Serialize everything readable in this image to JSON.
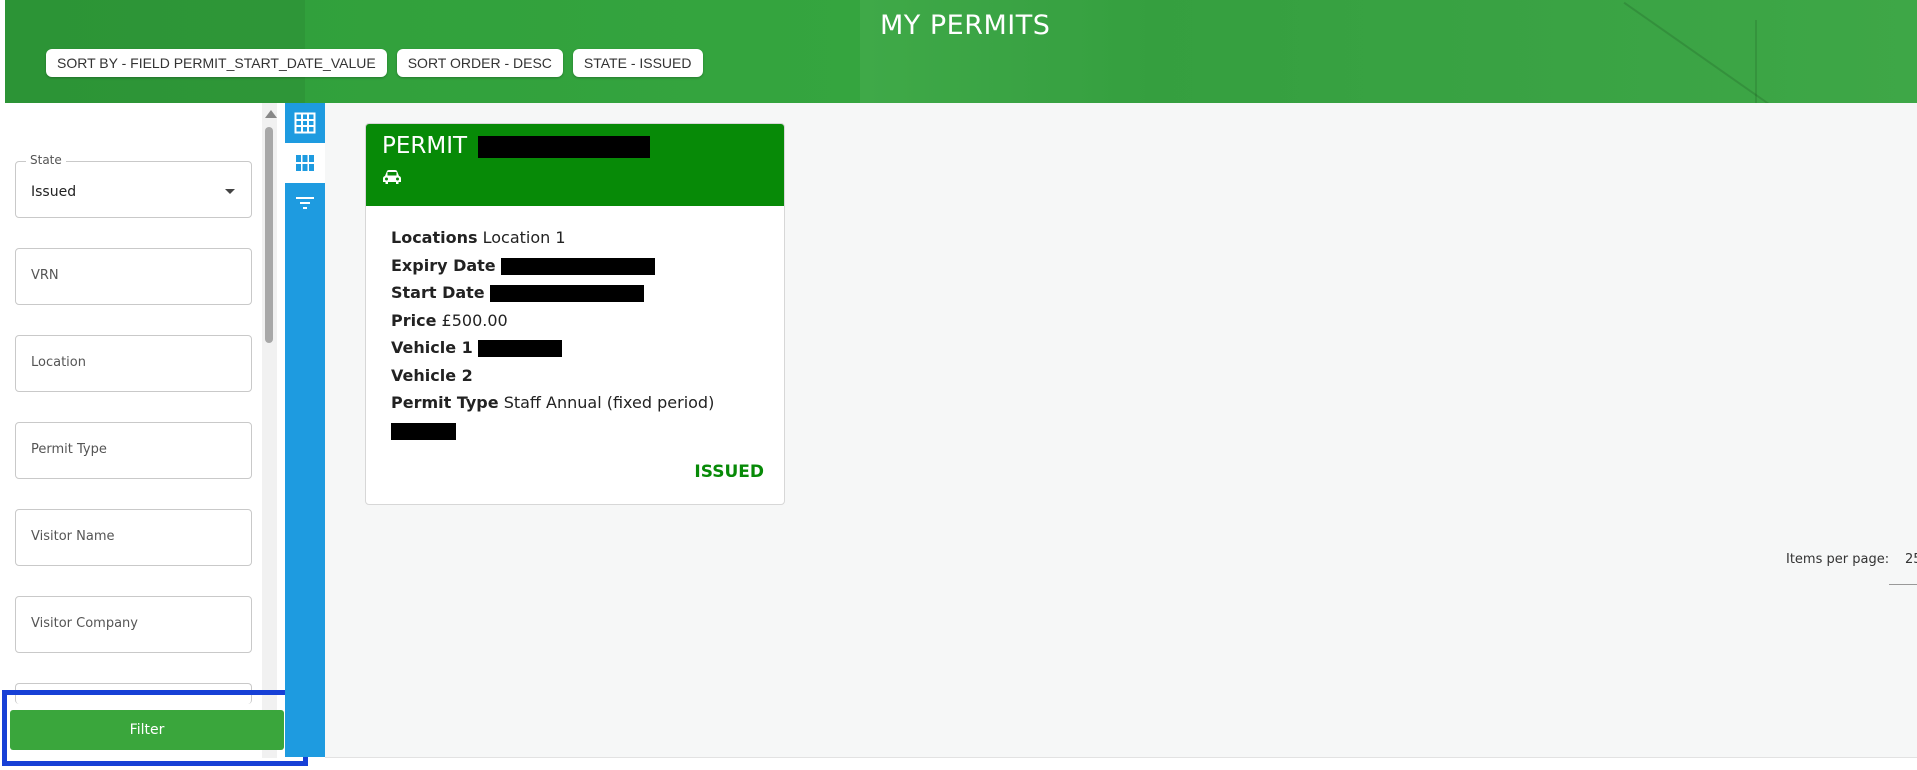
{
  "header": {
    "title": "MY PERMITS",
    "chips": [
      "SORT BY - FIELD PERMIT_START_DATE_VALUE",
      "SORT ORDER - DESC",
      "STATE - ISSUED"
    ]
  },
  "filters": {
    "state": {
      "label": "State",
      "value": "Issued"
    },
    "vrn_placeholder": "VRN",
    "location_placeholder": "Location",
    "permit_type_placeholder": "Permit Type",
    "visitor_name_placeholder": "Visitor Name",
    "visitor_company_placeholder": "Visitor Company",
    "filter_button": "Filter"
  },
  "toolbar": {
    "icons": [
      "grid-icon",
      "tiles-icon",
      "filter-list-icon"
    ]
  },
  "permit_card": {
    "title": "PERMIT",
    "vehicle_icon": "car-icon",
    "fields": {
      "locations_label": "Locations",
      "locations_value": "Location 1",
      "expiry_label": "Expiry Date",
      "start_label": "Start Date",
      "price_label": "Price",
      "price_value": "£500.00",
      "vehicle1_label": "Vehicle 1",
      "vehicle2_label": "Vehicle 2",
      "permit_type_label": "Permit Type",
      "permit_type_value": "Staff Annual (fixed period)"
    },
    "status": "ISSUED"
  },
  "pagination": {
    "items_per_page_label": "Items per page:",
    "items_per_page_value": "25"
  },
  "colors": {
    "header_green": "#34a33e",
    "card_green": "#078a07",
    "toolbar_blue": "#1e9be0",
    "filter_button": "#3aa63c",
    "highlight_blue": "#1740d6"
  }
}
